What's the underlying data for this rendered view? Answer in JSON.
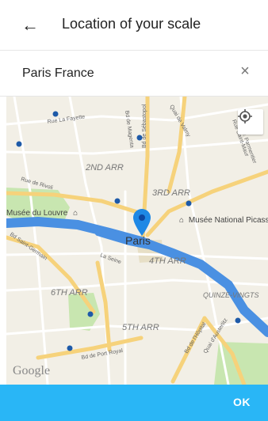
{
  "header": {
    "title": "Location of your scale",
    "back_icon": "arrow-left-icon"
  },
  "search": {
    "value": "Paris France",
    "clear_icon": "close-icon"
  },
  "map": {
    "labels": {
      "arr2": "2ND ARR",
      "arr3": "3RD ARR",
      "arr4": "4TH ARR",
      "arr5": "5TH ARR",
      "arr6": "6TH ARR",
      "quinze": "QUINZE-VINGTS",
      "city": "Paris"
    },
    "streets": {
      "rue_lafayette": "Rue La Fayette",
      "bd_magenta": "Bd de Magenta",
      "quai_valmy": "Quai de Valmy",
      "rue_saint_maur": "Rue Saint-Maur",
      "av_parmentier": "Av. Parmentier",
      "bd_sebastopol": "Bd de Sébastopol",
      "rue_rivoli": "Rue de Rivoli",
      "bd_st_germain": "Bd Saint-Germain",
      "la_seine": "La Seine",
      "bd_port_royal": "Bd de Port Royal",
      "bd_hopital": "Bd de l'Hôpital",
      "quai_austerlitz": "Quai d'Austerlitz"
    },
    "pois": {
      "louvre": "Musée du Louvre",
      "national": "Musée National Picass"
    },
    "attribution": "Google",
    "my_location_icon": "my-location-icon",
    "marker_icon": "map-pin-icon",
    "colors": {
      "land": "#f2efe6",
      "water": "#4a90e2",
      "park": "#c8e6b0",
      "road_major": "#f6d27b",
      "road_minor": "#ffffff",
      "marker": "#1e88e5"
    }
  },
  "footer": {
    "ok_label": "OK",
    "bar_color": "#29b6f6"
  }
}
